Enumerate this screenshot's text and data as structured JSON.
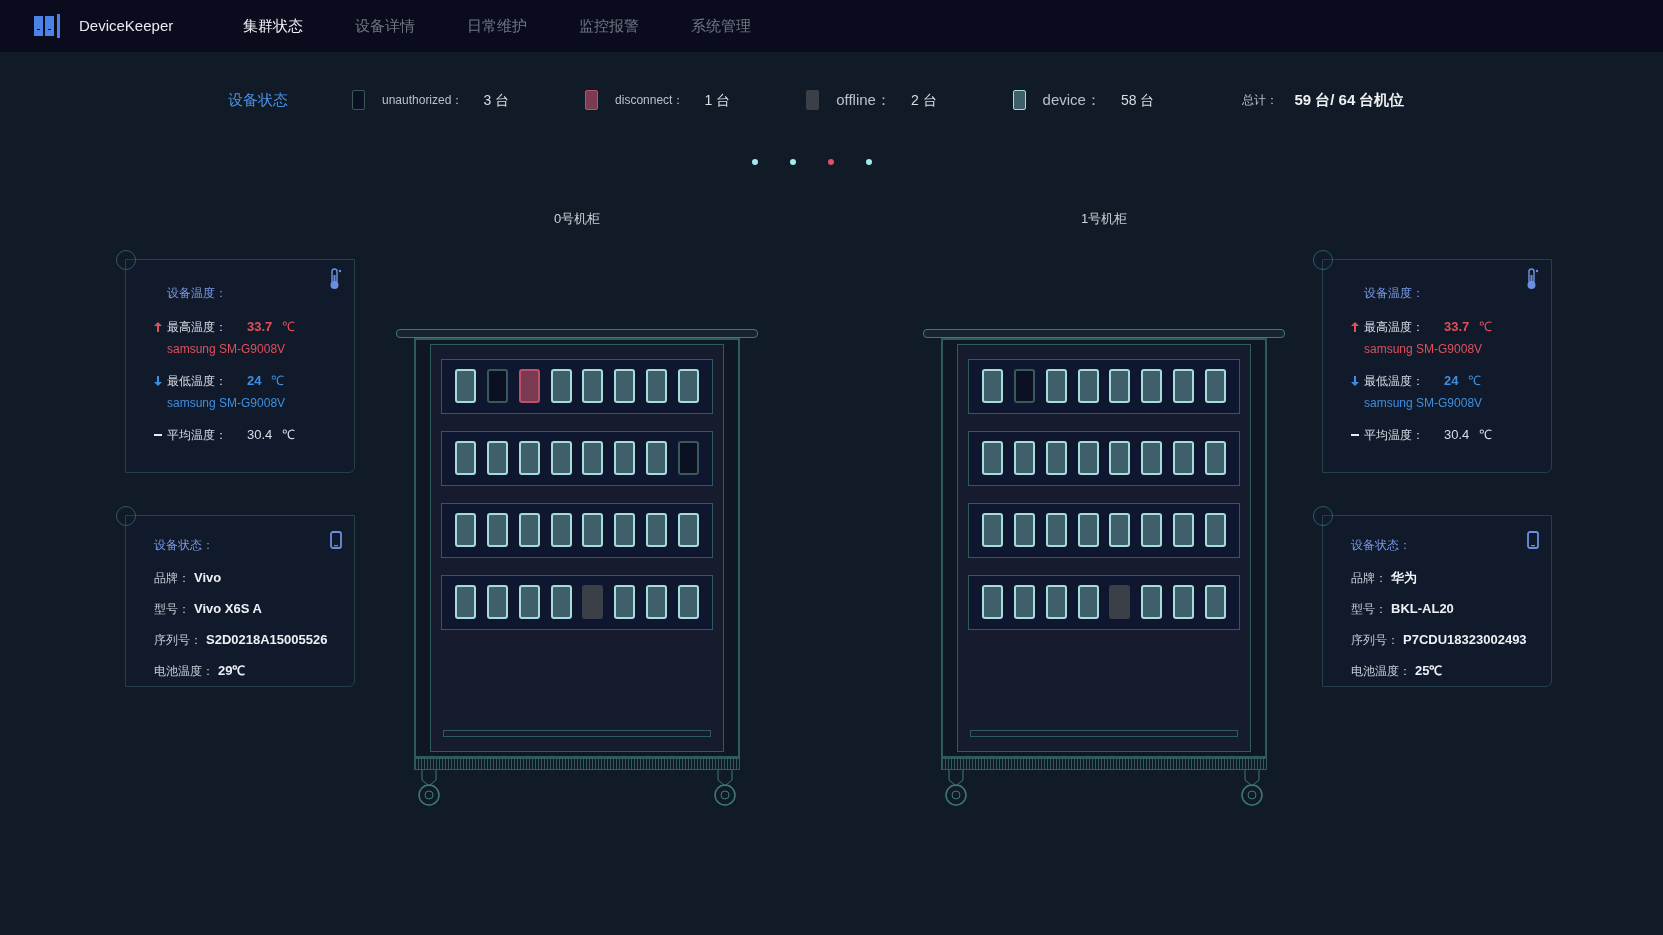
{
  "header": {
    "app_name": "DeviceKeeper",
    "nav": [
      {
        "label": "集群状态",
        "selected": true
      },
      {
        "label": "设备详情",
        "selected": false
      },
      {
        "label": "日常维护",
        "selected": false
      },
      {
        "label": "监控报警",
        "selected": false
      },
      {
        "label": "系统管理",
        "selected": false
      }
    ]
  },
  "status_bar": {
    "title": "设备状态",
    "legend": [
      {
        "kind": "unauthorized",
        "label": "unauthorized：",
        "count": "3 台"
      },
      {
        "kind": "disconnect",
        "label": "disconnect：",
        "count": "1 台"
      },
      {
        "kind": "offline",
        "label": "offline：",
        "count": "2 台"
      },
      {
        "kind": "device",
        "label": "device：",
        "count": "58 台"
      }
    ],
    "total_label": "总计：",
    "total_value": "59 台/ 64 台机位"
  },
  "pager": [
    {
      "selected": false
    },
    {
      "selected": false
    },
    {
      "selected": true
    },
    {
      "selected": false
    }
  ],
  "cabinets": [
    {
      "title": "0号机柜",
      "shelves": [
        {
          "slots": [
            {
              "kind": "device"
            },
            {
              "kind": "unauthorized"
            },
            {
              "kind": "disconnect"
            },
            {
              "kind": "device"
            },
            {
              "kind": "device"
            },
            {
              "kind": "device"
            },
            {
              "kind": "device"
            },
            {
              "kind": "device"
            }
          ]
        },
        {
          "slots": [
            {
              "kind": "device"
            },
            {
              "kind": "device"
            },
            {
              "kind": "device"
            },
            {
              "kind": "device"
            },
            {
              "kind": "device"
            },
            {
              "kind": "device"
            },
            {
              "kind": "device"
            },
            {
              "kind": "unauthorized"
            }
          ]
        },
        {
          "slots": [
            {
              "kind": "device"
            },
            {
              "kind": "device"
            },
            {
              "kind": "device"
            },
            {
              "kind": "device"
            },
            {
              "kind": "device"
            },
            {
              "kind": "device"
            },
            {
              "kind": "device"
            },
            {
              "kind": "device"
            }
          ]
        },
        {
          "slots": [
            {
              "kind": "device"
            },
            {
              "kind": "device"
            },
            {
              "kind": "device"
            },
            {
              "kind": "device"
            },
            {
              "kind": "offline"
            },
            {
              "kind": "device"
            },
            {
              "kind": "device"
            },
            {
              "kind": "device"
            }
          ]
        }
      ]
    },
    {
      "title": "1号机柜",
      "shelves": [
        {
          "slots": [
            {
              "kind": "device"
            },
            {
              "kind": "unauthorized"
            },
            {
              "kind": "device"
            },
            {
              "kind": "device"
            },
            {
              "kind": "device"
            },
            {
              "kind": "device"
            },
            {
              "kind": "device"
            },
            {
              "kind": "device"
            }
          ]
        },
        {
          "slots": [
            {
              "kind": "device"
            },
            {
              "kind": "device"
            },
            {
              "kind": "device"
            },
            {
              "kind": "device"
            },
            {
              "kind": "device"
            },
            {
              "kind": "device"
            },
            {
              "kind": "device"
            },
            {
              "kind": "device"
            }
          ]
        },
        {
          "slots": [
            {
              "kind": "device"
            },
            {
              "kind": "device"
            },
            {
              "kind": "device"
            },
            {
              "kind": "device"
            },
            {
              "kind": "device"
            },
            {
              "kind": "device"
            },
            {
              "kind": "device"
            },
            {
              "kind": "device"
            }
          ]
        },
        {
          "slots": [
            {
              "kind": "device"
            },
            {
              "kind": "device"
            },
            {
              "kind": "device"
            },
            {
              "kind": "device"
            },
            {
              "kind": "offline"
            },
            {
              "kind": "device"
            },
            {
              "kind": "device"
            },
            {
              "kind": "device"
            }
          ]
        }
      ]
    }
  ],
  "side_panels": [
    {
      "temperature": {
        "title": "设备温度：",
        "rows": [
          {
            "kind": "max",
            "label": "最高温度：",
            "value": "33.7",
            "unit": "℃",
            "device": "samsung SM-G9008V"
          },
          {
            "kind": "min",
            "label": "最低温度：",
            "value": "24",
            "unit": "℃",
            "device": "samsung SM-G9008V"
          },
          {
            "kind": "avg",
            "label": "平均温度：",
            "value": "30.4",
            "unit": "℃"
          }
        ]
      },
      "device": {
        "title": "设备状态：",
        "fields": [
          {
            "label": "品牌：",
            "value": "Vivo"
          },
          {
            "label": "型号：",
            "value": "Vivo X6S A"
          },
          {
            "label": "序列号：",
            "value": "S2D0218A15005526"
          },
          {
            "label": "电池温度：",
            "value": "29℃"
          }
        ]
      }
    },
    {
      "temperature": {
        "title": "设备温度：",
        "rows": [
          {
            "kind": "max",
            "label": "最高温度：",
            "value": "33.7",
            "unit": "℃",
            "device": "samsung SM-G9008V"
          },
          {
            "kind": "min",
            "label": "最低温度：",
            "value": "24",
            "unit": "℃",
            "device": "samsung SM-G9008V"
          },
          {
            "kind": "avg",
            "label": "平均温度：",
            "value": "30.4",
            "unit": "℃"
          }
        ]
      },
      "device": {
        "title": "设备状态：",
        "fields": [
          {
            "label": "品牌：",
            "value": "华为"
          },
          {
            "label": "型号：",
            "value": "BKL-AL20"
          },
          {
            "label": "序列号：",
            "value": "P7CDU18323002493"
          },
          {
            "label": "电池温度：",
            "value": "25℃"
          }
        ]
      }
    }
  ]
}
